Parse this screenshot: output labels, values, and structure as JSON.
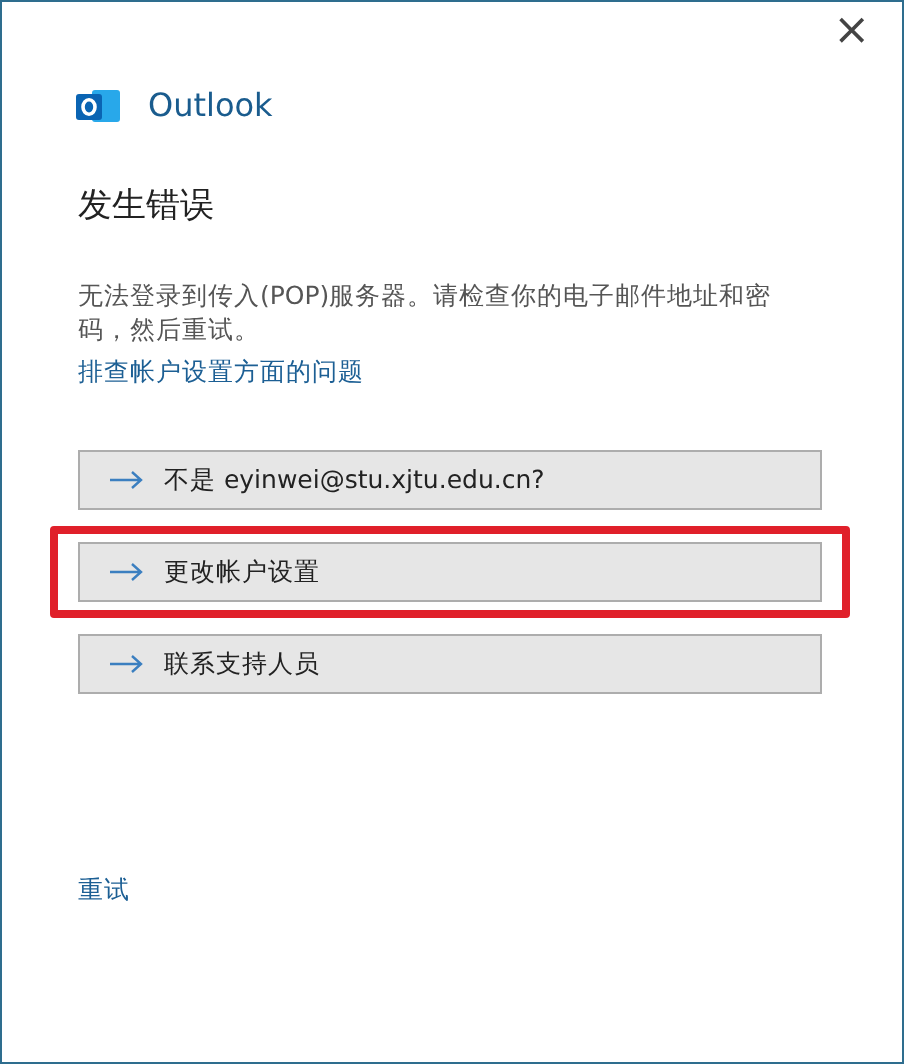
{
  "window": {
    "close": "×"
  },
  "brand": "Outlook",
  "heading": "发生错误",
  "message": "无法登录到传入(POP)服务器。请检查你的电子邮件地址和密码，然后重试。",
  "help_link": "排查帐户设置方面的问题",
  "options": [
    {
      "label": "不是 eyinwei@stu.xjtu.edu.cn?",
      "highlighted": false
    },
    {
      "label": "更改帐户设置",
      "highlighted": true
    },
    {
      "label": "联系支持人员",
      "highlighted": false
    }
  ],
  "retry": "重试"
}
